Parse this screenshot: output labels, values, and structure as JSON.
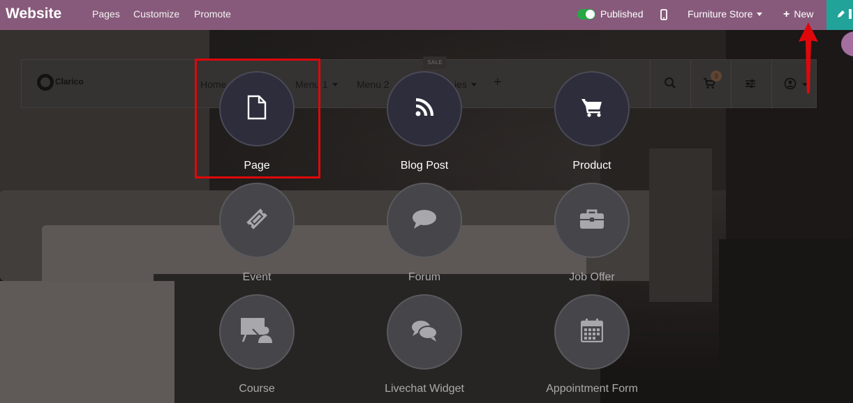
{
  "topbar": {
    "brand": "Website",
    "menu": [
      "Pages",
      "Customize",
      "Promote"
    ],
    "published_label": "Published",
    "site_selector": "Furniture Store",
    "new_label": "New"
  },
  "site_nav": {
    "logo_text": "Clarico",
    "menu": [
      "Home",
      "Menu 1",
      "Menu 2",
      "ies"
    ],
    "sale_tag": "SALE",
    "cart_count": "3"
  },
  "tiles": [
    {
      "label": "Page",
      "icon": "file-icon",
      "state": "active"
    },
    {
      "label": "Blog Post",
      "icon": "rss-icon",
      "state": "active"
    },
    {
      "label": "Product",
      "icon": "cart-icon",
      "state": "active"
    },
    {
      "label": "Event",
      "icon": "ticket-icon",
      "state": "inactive"
    },
    {
      "label": "Forum",
      "icon": "comment-icon",
      "state": "inactive"
    },
    {
      "label": "Job Offer",
      "icon": "briefcase-icon",
      "state": "inactive"
    },
    {
      "label": "Course",
      "icon": "presentation-icon",
      "state": "inactive"
    },
    {
      "label": "Livechat Widget",
      "icon": "comments-icon",
      "state": "inactive"
    },
    {
      "label": "Appointment Form",
      "icon": "calendar-icon",
      "state": "inactive"
    }
  ],
  "colors": {
    "topbar": "#875a7b",
    "edit": "#21a39a",
    "highlight": "#e0070a",
    "toggle_on": "#28a745"
  }
}
